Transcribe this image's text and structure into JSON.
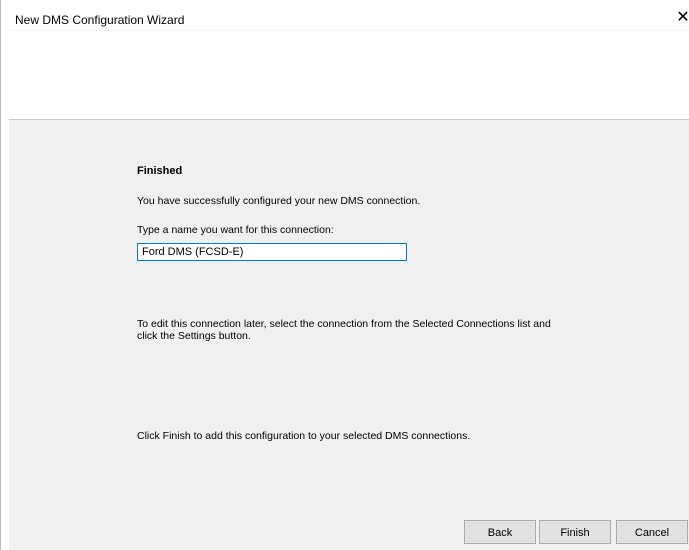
{
  "window": {
    "title": "New DMS Configuration Wizard",
    "close_glyph": "✕"
  },
  "content": {
    "heading": "Finished",
    "success_text": "You have successfully configured your new DMS connection.",
    "name_prompt": "Type a name you want for this connection:",
    "connection_name_value": "Ford DMS (FCSD-E)",
    "edit_hint_line1": "To edit this connection later, select the connection from the Selected Connections list and",
    "edit_hint_line2": "click the Settings button.",
    "finish_hint": "Click Finish to add this configuration to your selected DMS connections."
  },
  "buttons": {
    "back": "Back",
    "finish": "Finish",
    "cancel": "Cancel"
  },
  "colors": {
    "panel_bg": "#f0f0f0",
    "input_focus_border": "#0078d7",
    "button_bg": "#e1e1e1"
  }
}
